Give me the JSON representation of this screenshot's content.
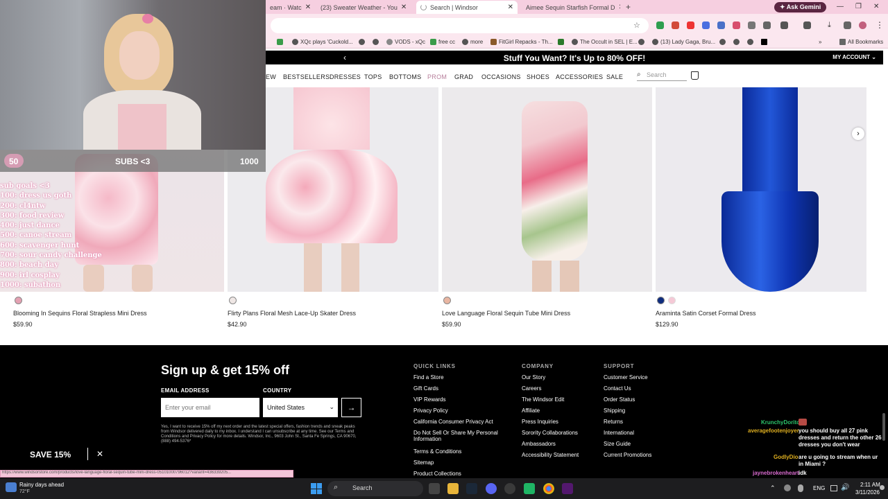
{
  "browser": {
    "tabs": [
      {
        "label": "eam · Watc",
        "active": false
      },
      {
        "label": "(23) Sweater Weather - You",
        "active": false
      },
      {
        "label": "Search | Windsor",
        "active": true
      },
      {
        "label": "Aimee Sequin Starfish Formal D",
        "active": false
      }
    ],
    "ask_gemini": "Ask Gemini",
    "bookmarks": [
      "XQc plays 'Cuckold...",
      "VODS - xQc",
      "free cc",
      "more",
      "FitGirl Repacks - Th...",
      "The Occult in SEL | E...",
      "(13) Lady Gaga, Bru...",
      "All Bookmarks"
    ],
    "status_url": "https://www.windsorstore.com/products/love-language-floral-sequin-tube-mini-dress-05101000796012?variant=436339205..."
  },
  "site": {
    "promo": "Stuff You Want? It's Up to 80% OFF!",
    "my_account": "MY ACCOUNT",
    "nav": [
      "EW",
      "BESTSELLERS",
      "DRESSES",
      "TOPS",
      "BOTTOMS",
      "PROM",
      "GRAD",
      "OCCASIONS",
      "SHOES",
      "ACCESSORIES",
      "SALE"
    ],
    "search_placeholder": "Search",
    "products": [
      {
        "name": "Blooming In Sequins Floral Strapless Mini Dress",
        "price": "$59.90",
        "swatches": [
          "#e4a1b2"
        ]
      },
      {
        "name": "Flirty Plans Floral Mesh Lace-Up Skater Dress",
        "price": "$42.90",
        "swatches": [
          "#efe7e5"
        ]
      },
      {
        "name": "Love Language Floral Sequin Tube Mini Dress",
        "price": "$59.90",
        "swatches": [
          "#e9b6a2"
        ]
      },
      {
        "name": "Araminta Satin Corset Formal Dress",
        "price": "$129.90",
        "swatches": [
          "#0e2c7e",
          "#f5c9d6"
        ]
      }
    ]
  },
  "footer": {
    "signup_title": "Sign up & get 15% off",
    "email_label": "EMAIL ADDRESS",
    "email_placeholder": "Enter your email",
    "country_label": "COUNTRY",
    "country_value": "United States",
    "submit_arrow": "→",
    "legal": "Yes, I want to receive 15% off my next order and the latest special offers, fashion trends and sneak peaks from Windsor delivered daily to my inbox. I understand I can unsubscribe at any time. See our Terms and Conditions and Privacy Policy for more details. Windsor, Inc., 9603 John St., Santa Fe Springs, CA 90670, (888) 494-5376*",
    "columns": [
      {
        "title": "QUICK LINKS",
        "links": [
          "Find a Store",
          "Gift Cards",
          "VIP Rewards",
          "Privacy Policy",
          "California Consumer Privacy Act",
          "Do Not Sell Or Share My Personal Information",
          "Terms & Conditions",
          "Sitemap",
          "Product Collections"
        ]
      },
      {
        "title": "COMPANY",
        "links": [
          "Our Story",
          "Careers",
          "The Windsor Edit",
          "Affiliate",
          "Press Inquiries",
          "Sorority Collaborations",
          "Ambassadors",
          "Accessibility Statement"
        ]
      },
      {
        "title": "SUPPORT",
        "links": [
          "Customer Service",
          "Contact Us",
          "Order Status",
          "Shipping",
          "Returns",
          "International",
          "Size Guide",
          "Current Promotions"
        ]
      }
    ],
    "save_label": "SAVE 15%",
    "save_close": "✕"
  },
  "overlay": {
    "sub_start": "50",
    "sub_label": "SUBS <3",
    "sub_goal": "1000",
    "goals": [
      "sub goals <3",
      "100: dress us goth",
      "200: cl4ntw",
      "300: food review",
      "400: just dance",
      "500: canoe stream",
      "600: scavenger hunt",
      "700: sour candy challenge",
      "800: beach day",
      "900: irl cosplay",
      "1000: subathon"
    ],
    "chat": [
      {
        "user": "KrunchyDorito",
        "msg": "",
        "color": "#2cc36b"
      },
      {
        "user": "averagefootenjoyer",
        "msg": "you should buy all 27 pink dresses and return the other 26 dresses you don't wear",
        "color": "#e0b020"
      },
      {
        "user": "GodlyDio",
        "msg": "are u going to stream when ur in Miami ?",
        "color": "#e0b020"
      },
      {
        "user": "jaynebrokenheart",
        "msg": "idk",
        "color": "#d96bd0"
      }
    ]
  },
  "taskbar": {
    "weather_title": "Rainy days ahead",
    "weather_temp": "72°F",
    "search": "Search",
    "lang": "ENG",
    "time": "2:11 AM",
    "date": "3/11/2026"
  }
}
